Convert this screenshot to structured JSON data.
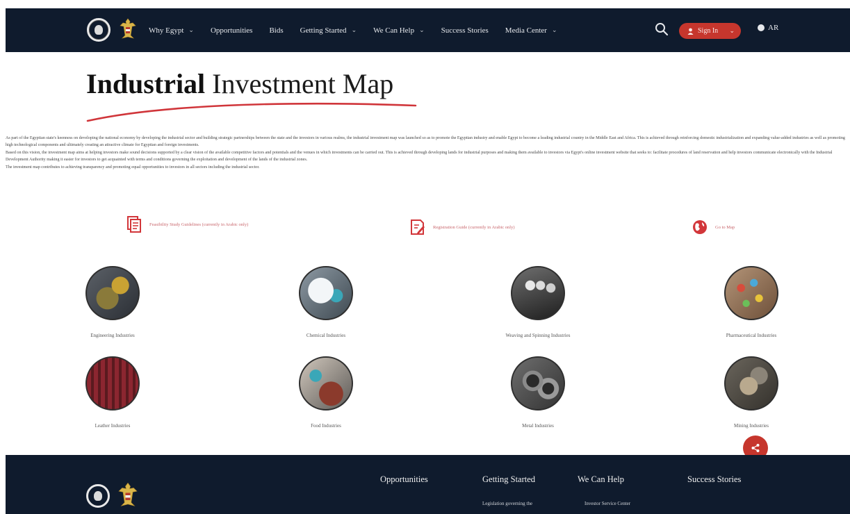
{
  "header": {
    "nav": [
      {
        "label": "Why Egypt",
        "dropdown": true
      },
      {
        "label": "Opportunities",
        "dropdown": false
      },
      {
        "label": "Bids",
        "dropdown": false
      },
      {
        "label": "Getting Started",
        "dropdown": true
      },
      {
        "label": "We Can Help",
        "dropdown": true
      },
      {
        "label": "Success Stories",
        "dropdown": false
      },
      {
        "label": "Media Center",
        "dropdown": true
      }
    ],
    "signin_label": "Sign In",
    "lang_label": "AR"
  },
  "title": {
    "bold": "Industrial",
    "light": "Investment Map"
  },
  "intro": [
    "As part of the Egyptian state's keenness on developing the national economy by developing the industrial sector and building strategic partnerships between the state and the investors in various realms, the industrial investment map was launched so as to promote the Egyptian industry and enable Egypt to become a leading industrial country in the Middle East and Africa. This is achieved through reinforcing domestic industrialization and expanding value-added industries as well as promoting high technological components and ultimately creating an attractive climate for Egyptian and foreign investments.",
    "Based on this vision, the investment map aims at helping investors make sound decisions supported by a clear vision of the available competitive factors and potentials and the venues in which investments can be carried out. This is achieved through developing lands for industrial purposes and making them available to investors via Egypt's online investment website that seeks to: facilitate procedures of land reservation and help investors communicate electronically with the Industrial Development Authority making it easier for investors to get acquainted with terms and conditions governing the exploitation and development of the lands of the industrial zones.",
    "The investment map contributes to achieving transparency and promoting equal opportunities to investors in all sectors including the industrial sector."
  ],
  "links": [
    {
      "label": "Feasibility Study Guidelines (currently in Arabic only)",
      "icon": "document-icon"
    },
    {
      "label": "Registration Guide (currently in Arabic only)",
      "icon": "edit-document-icon"
    },
    {
      "label": "Go to Map",
      "icon": "globe-icon"
    }
  ],
  "categories": [
    {
      "label": "Engineering Industries",
      "colors": [
        "#3a3f45",
        "#8a7a3a",
        "#c9a233"
      ]
    },
    {
      "label": "Chemical Industries",
      "colors": [
        "#6e7b86",
        "#e9eef2",
        "#3aa7b8"
      ]
    },
    {
      "label": "Weaving and Spinning Industries",
      "colors": [
        "#2e2e2e",
        "#9a9a9a",
        "#e8e8e8"
      ]
    },
    {
      "label": "Pharmaceutical Industries",
      "colors": [
        "#7a5a3e",
        "#d74c3c",
        "#4aa9d9"
      ]
    },
    {
      "label": "Leather Industries",
      "colors": [
        "#3b0f14",
        "#8c2630",
        "#5a1a1f"
      ]
    },
    {
      "label": "Food Industries",
      "colors": [
        "#5d5a57",
        "#c8bfb5",
        "#8b3a2c"
      ]
    },
    {
      "label": "Metal Industries",
      "colors": [
        "#2a2a2a",
        "#6e6e6e",
        "#a9a9a9"
      ]
    },
    {
      "label": "Mining Industries",
      "colors": [
        "#4a4640",
        "#8b8478",
        "#b9a98e"
      ]
    }
  ],
  "footer": {
    "columns": [
      "Opportunities",
      "Getting Started",
      "We Can Help",
      "Success Stories"
    ],
    "getting_started_item": "Legislation governing the",
    "we_can_help_item": "Investor Service Center"
  },
  "colors": {
    "navy": "#0f1b2d",
    "accent_red": "#c6362d",
    "link_pink": "#c8656b"
  }
}
